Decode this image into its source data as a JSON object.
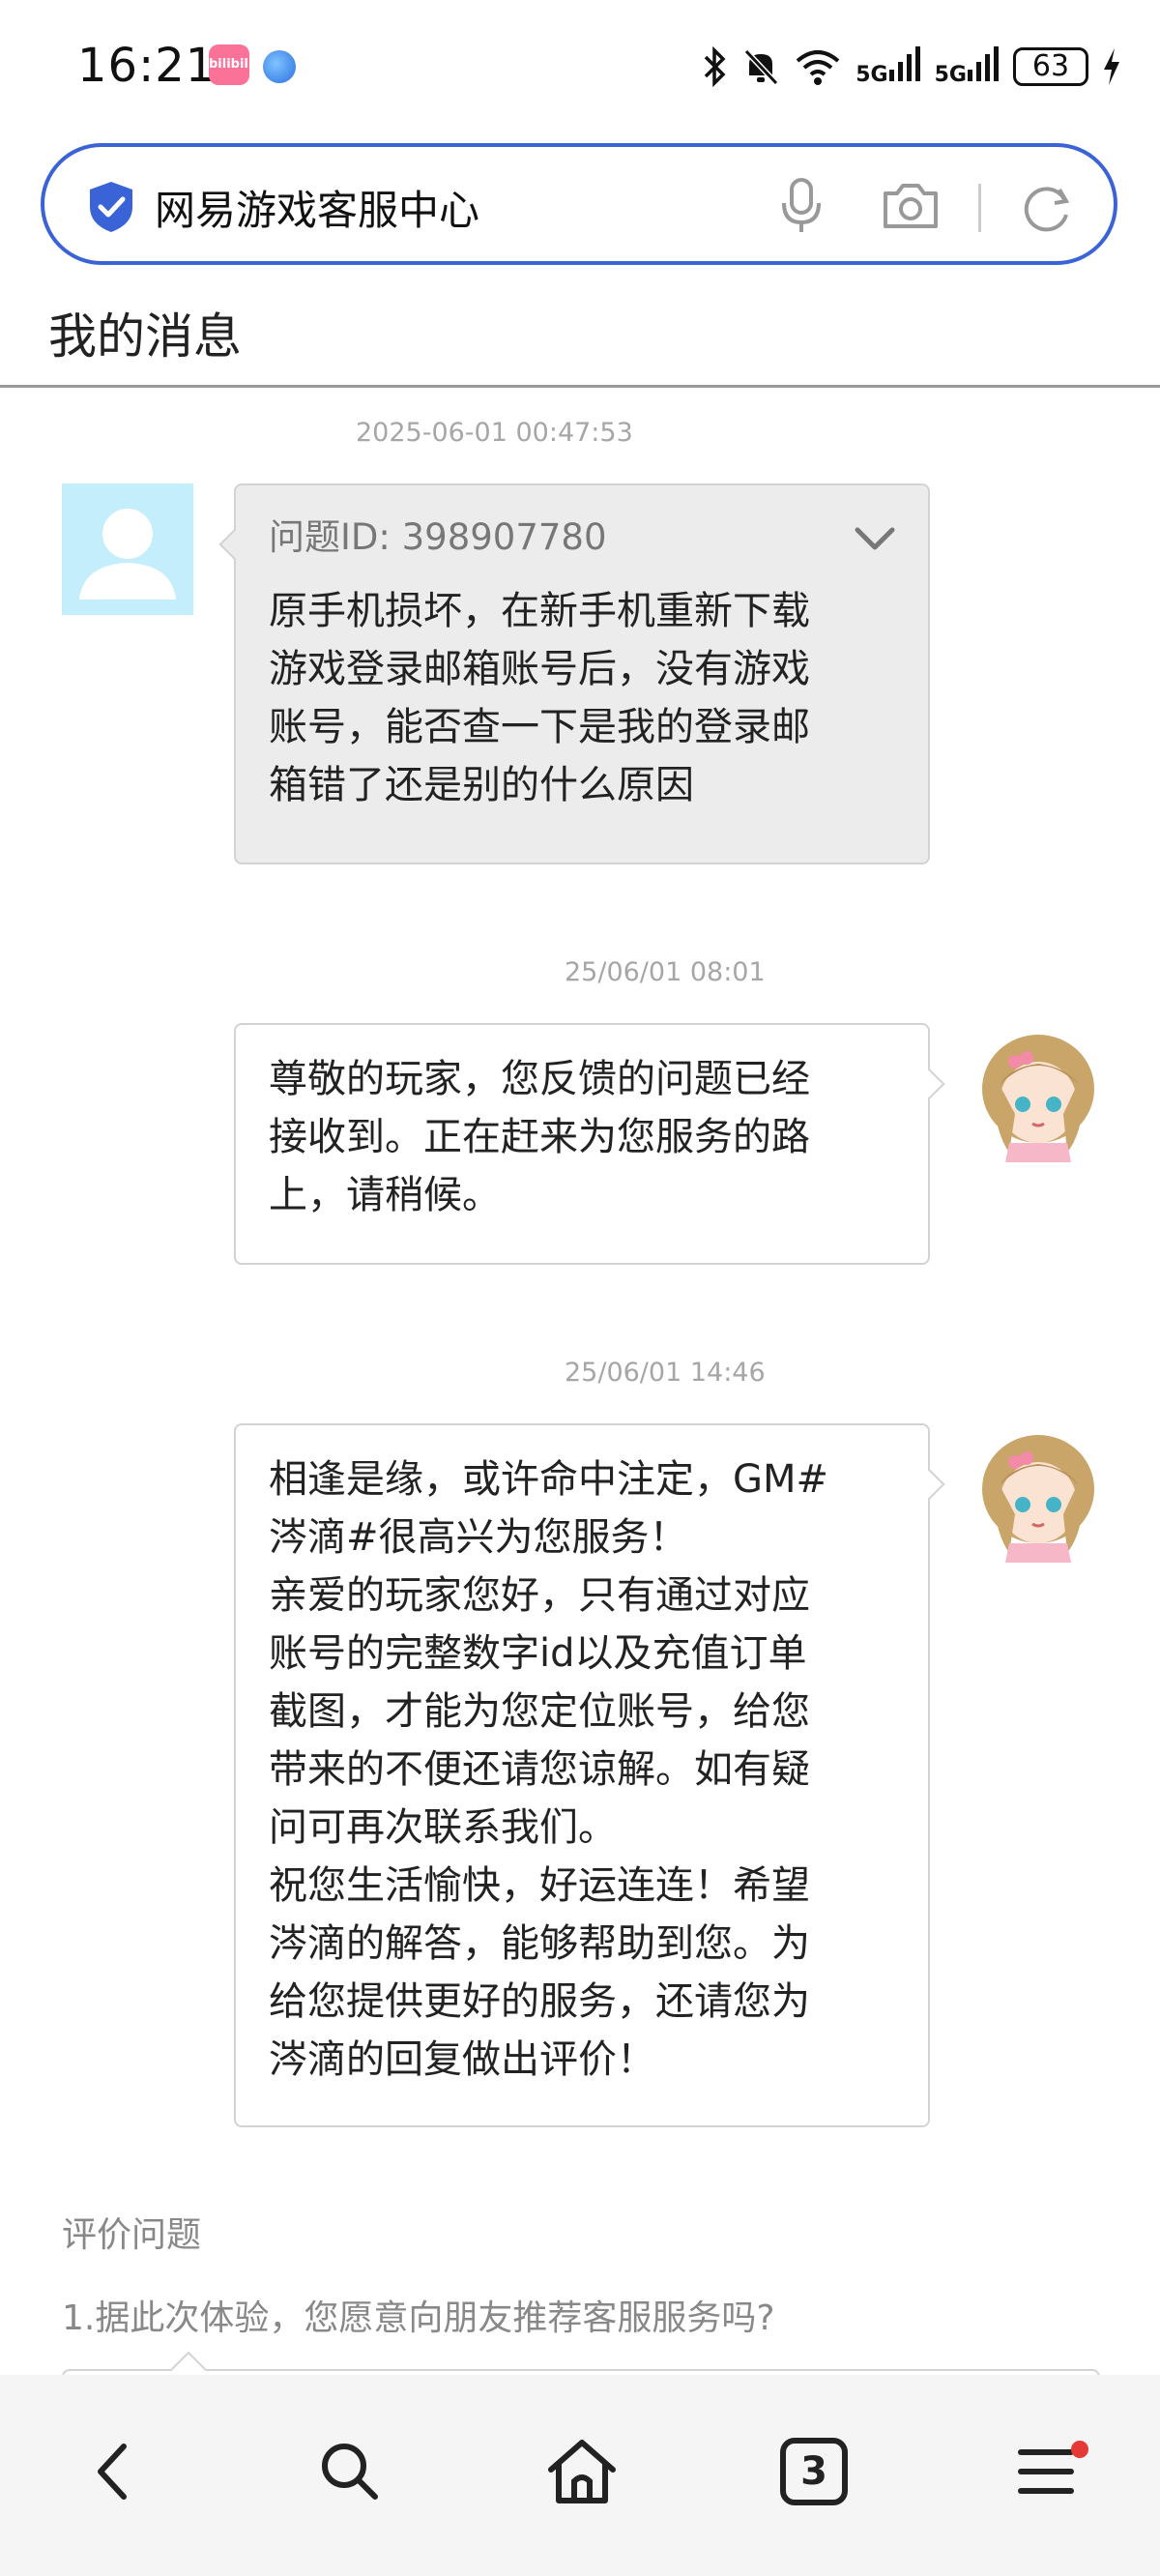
{
  "status_bar": {
    "time": "16:21",
    "app_badge": "bilibili",
    "network": "5G",
    "network2": "5G",
    "battery": "63"
  },
  "search": {
    "text": "网易游戏客服中心"
  },
  "page": {
    "title": "我的消息"
  },
  "messages": [
    {
      "sender": "user",
      "timestamp": "2025-06-01 00:47:53",
      "ticket_label": "问题ID: 398907780",
      "lines": [
        "原手机损坏，在新手机重新下载",
        "游戏登录邮箱账号后，没有游戏",
        "账号，能否查一下是我的登录邮",
        "箱错了还是别的什么原因"
      ]
    },
    {
      "sender": "gm",
      "timestamp": "25/06/01 08:01",
      "lines": [
        "尊敬的玩家，您反馈的问题已经",
        "接收到。正在赶来为您服务的路",
        "上，请稍候。"
      ]
    },
    {
      "sender": "gm",
      "timestamp": "25/06/01 14:46",
      "lines": [
        "相逢是缘，或许命中注定，GM#",
        "涔滴#很高兴为您服务！",
        "亲爱的玩家您好，只有通过对应",
        "账号的完整数字id以及充值订单",
        "截图，才能为您定位账号，给您",
        "带来的不便还请您谅解。如有疑",
        "问可再次联系我们。",
        "祝您生活愉快，好运连连！希望",
        "涔滴的解答，能够帮助到您。为",
        "给您提供更好的服务，还请您为",
        "涔滴的回复做出评价！"
      ]
    }
  ],
  "evaluation": {
    "title": "评价问题",
    "question": "1.据此次体验，您愿意向朋友推荐客服服务吗?"
  },
  "bottom_nav": {
    "tab_count": "3"
  },
  "colors": {
    "accent": "#3a63d8",
    "user_bubble": "#ececec",
    "notification_dot": "#e53935"
  }
}
